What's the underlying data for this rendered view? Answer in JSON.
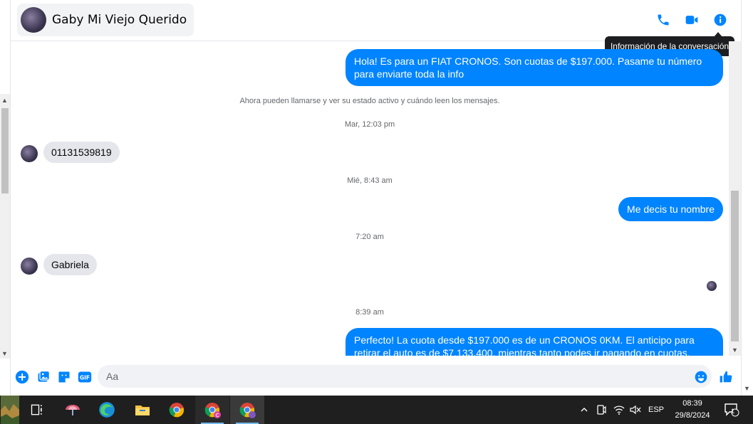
{
  "header": {
    "contact_name": "Gaby Mi Viejo Querido",
    "tooltip": "Información de la conversación"
  },
  "icons": {
    "phone": "phone-icon",
    "video": "video-camera-icon",
    "info": "info-icon"
  },
  "colors": {
    "accent": "#0084ff",
    "bubble_in": "#e4e6eb",
    "taskbar": "#1f1f1f"
  },
  "messages": [
    {
      "type": "out",
      "text": "Hola! Es para un FIAT CRONOS. Son cuotas de $197.000. Pasame tu número para enviarte toda la info"
    },
    {
      "type": "system",
      "text": "Ahora pueden llamarse y ver su estado activo y cuándo leen los mensajes."
    },
    {
      "type": "time",
      "text": "Mar, 12:03 pm"
    },
    {
      "type": "in",
      "text": "01131539819"
    },
    {
      "type": "time",
      "text": "Mié, 8:43 am"
    },
    {
      "type": "out",
      "text": "Me decis tu nombre"
    },
    {
      "type": "time",
      "text": "7:20 am"
    },
    {
      "type": "in",
      "text": "Gabriela"
    },
    {
      "type": "time",
      "text": "8:39 am"
    },
    {
      "type": "out",
      "text": "Perfecto! La cuota desde $197.000 es de un CRONOS 0KM. El anticipo para retirar el auto es de $7.133.400, mientras tanto podes ir pagando en cuotas. Cuándo podes"
    }
  ],
  "composer": {
    "placeholder": "Aa"
  },
  "taskbar": {
    "language": "ESP",
    "time": "08:39",
    "date": "29/8/2024",
    "notification_count": "1"
  }
}
